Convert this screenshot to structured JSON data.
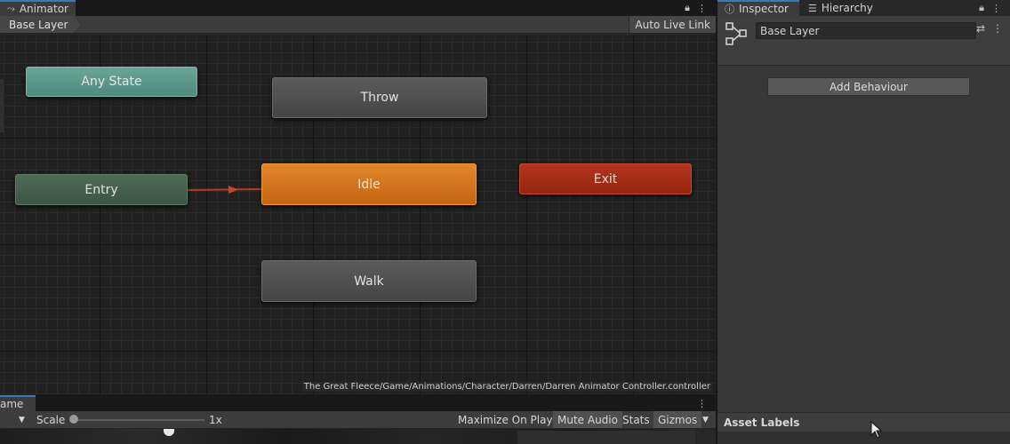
{
  "animator": {
    "tab_label": "Animator",
    "breadcrumb": "Base Layer",
    "auto_live_link": "Auto Live Link",
    "controller_path": "The Great Fleece/Game/Animations/Character/Darren/Darren Animator Controller.controller",
    "states": {
      "any_state": "Any State",
      "throw": "Throw",
      "entry": "Entry",
      "idle": "Idle",
      "exit": "Exit",
      "walk": "Walk"
    },
    "colors": {
      "default_state": "#4f4f4f",
      "any_state": "#5e9a8f",
      "entry": "#465f4c",
      "idle_default": "#d87519",
      "exit": "#a82d17",
      "transition": "#b83a26"
    }
  },
  "inspector": {
    "tab_inspector": "Inspector",
    "tab_hierarchy": "Hierarchy",
    "layer_name": "Base Layer",
    "add_behaviour": "Add Behaviour",
    "asset_labels": "Asset Labels"
  },
  "game": {
    "tab_label": "ame",
    "scale_label": "Scale",
    "scale_value": "1x",
    "maximize_on_play": "Maximize On Play",
    "mute_audio": "Mute Audio",
    "stats": "Stats",
    "gizmos": "Gizmos"
  }
}
